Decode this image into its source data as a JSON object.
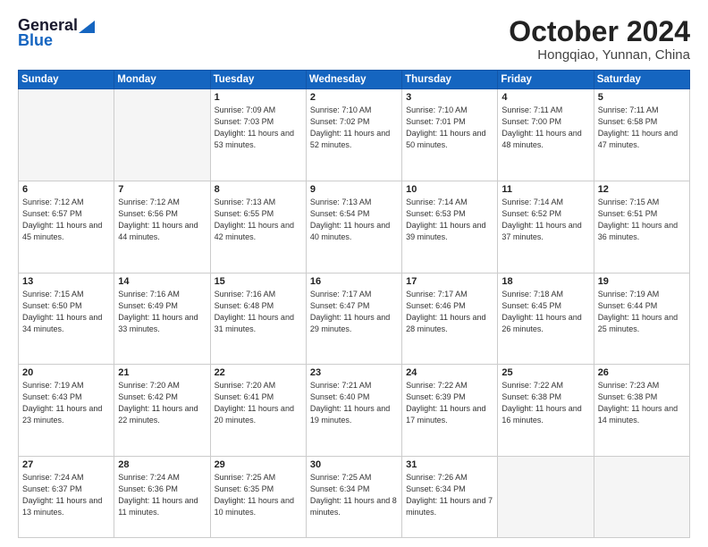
{
  "header": {
    "logo_general": "General",
    "logo_blue": "Blue",
    "title": "October 2024",
    "location": "Hongqiao, Yunnan, China"
  },
  "weekdays": [
    "Sunday",
    "Monday",
    "Tuesday",
    "Wednesday",
    "Thursday",
    "Friday",
    "Saturday"
  ],
  "weeks": [
    [
      {
        "day": "",
        "info": ""
      },
      {
        "day": "",
        "info": ""
      },
      {
        "day": "1",
        "info": "Sunrise: 7:09 AM\nSunset: 7:03 PM\nDaylight: 11 hours and 53 minutes."
      },
      {
        "day": "2",
        "info": "Sunrise: 7:10 AM\nSunset: 7:02 PM\nDaylight: 11 hours and 52 minutes."
      },
      {
        "day": "3",
        "info": "Sunrise: 7:10 AM\nSunset: 7:01 PM\nDaylight: 11 hours and 50 minutes."
      },
      {
        "day": "4",
        "info": "Sunrise: 7:11 AM\nSunset: 7:00 PM\nDaylight: 11 hours and 48 minutes."
      },
      {
        "day": "5",
        "info": "Sunrise: 7:11 AM\nSunset: 6:58 PM\nDaylight: 11 hours and 47 minutes."
      }
    ],
    [
      {
        "day": "6",
        "info": "Sunrise: 7:12 AM\nSunset: 6:57 PM\nDaylight: 11 hours and 45 minutes."
      },
      {
        "day": "7",
        "info": "Sunrise: 7:12 AM\nSunset: 6:56 PM\nDaylight: 11 hours and 44 minutes."
      },
      {
        "day": "8",
        "info": "Sunrise: 7:13 AM\nSunset: 6:55 PM\nDaylight: 11 hours and 42 minutes."
      },
      {
        "day": "9",
        "info": "Sunrise: 7:13 AM\nSunset: 6:54 PM\nDaylight: 11 hours and 40 minutes."
      },
      {
        "day": "10",
        "info": "Sunrise: 7:14 AM\nSunset: 6:53 PM\nDaylight: 11 hours and 39 minutes."
      },
      {
        "day": "11",
        "info": "Sunrise: 7:14 AM\nSunset: 6:52 PM\nDaylight: 11 hours and 37 minutes."
      },
      {
        "day": "12",
        "info": "Sunrise: 7:15 AM\nSunset: 6:51 PM\nDaylight: 11 hours and 36 minutes."
      }
    ],
    [
      {
        "day": "13",
        "info": "Sunrise: 7:15 AM\nSunset: 6:50 PM\nDaylight: 11 hours and 34 minutes."
      },
      {
        "day": "14",
        "info": "Sunrise: 7:16 AM\nSunset: 6:49 PM\nDaylight: 11 hours and 33 minutes."
      },
      {
        "day": "15",
        "info": "Sunrise: 7:16 AM\nSunset: 6:48 PM\nDaylight: 11 hours and 31 minutes."
      },
      {
        "day": "16",
        "info": "Sunrise: 7:17 AM\nSunset: 6:47 PM\nDaylight: 11 hours and 29 minutes."
      },
      {
        "day": "17",
        "info": "Sunrise: 7:17 AM\nSunset: 6:46 PM\nDaylight: 11 hours and 28 minutes."
      },
      {
        "day": "18",
        "info": "Sunrise: 7:18 AM\nSunset: 6:45 PM\nDaylight: 11 hours and 26 minutes."
      },
      {
        "day": "19",
        "info": "Sunrise: 7:19 AM\nSunset: 6:44 PM\nDaylight: 11 hours and 25 minutes."
      }
    ],
    [
      {
        "day": "20",
        "info": "Sunrise: 7:19 AM\nSunset: 6:43 PM\nDaylight: 11 hours and 23 minutes."
      },
      {
        "day": "21",
        "info": "Sunrise: 7:20 AM\nSunset: 6:42 PM\nDaylight: 11 hours and 22 minutes."
      },
      {
        "day": "22",
        "info": "Sunrise: 7:20 AM\nSunset: 6:41 PM\nDaylight: 11 hours and 20 minutes."
      },
      {
        "day": "23",
        "info": "Sunrise: 7:21 AM\nSunset: 6:40 PM\nDaylight: 11 hours and 19 minutes."
      },
      {
        "day": "24",
        "info": "Sunrise: 7:22 AM\nSunset: 6:39 PM\nDaylight: 11 hours and 17 minutes."
      },
      {
        "day": "25",
        "info": "Sunrise: 7:22 AM\nSunset: 6:38 PM\nDaylight: 11 hours and 16 minutes."
      },
      {
        "day": "26",
        "info": "Sunrise: 7:23 AM\nSunset: 6:38 PM\nDaylight: 11 hours and 14 minutes."
      }
    ],
    [
      {
        "day": "27",
        "info": "Sunrise: 7:24 AM\nSunset: 6:37 PM\nDaylight: 11 hours and 13 minutes."
      },
      {
        "day": "28",
        "info": "Sunrise: 7:24 AM\nSunset: 6:36 PM\nDaylight: 11 hours and 11 minutes."
      },
      {
        "day": "29",
        "info": "Sunrise: 7:25 AM\nSunset: 6:35 PM\nDaylight: 11 hours and 10 minutes."
      },
      {
        "day": "30",
        "info": "Sunrise: 7:25 AM\nSunset: 6:34 PM\nDaylight: 11 hours and 8 minutes."
      },
      {
        "day": "31",
        "info": "Sunrise: 7:26 AM\nSunset: 6:34 PM\nDaylight: 11 hours and 7 minutes."
      },
      {
        "day": "",
        "info": ""
      },
      {
        "day": "",
        "info": ""
      }
    ]
  ]
}
